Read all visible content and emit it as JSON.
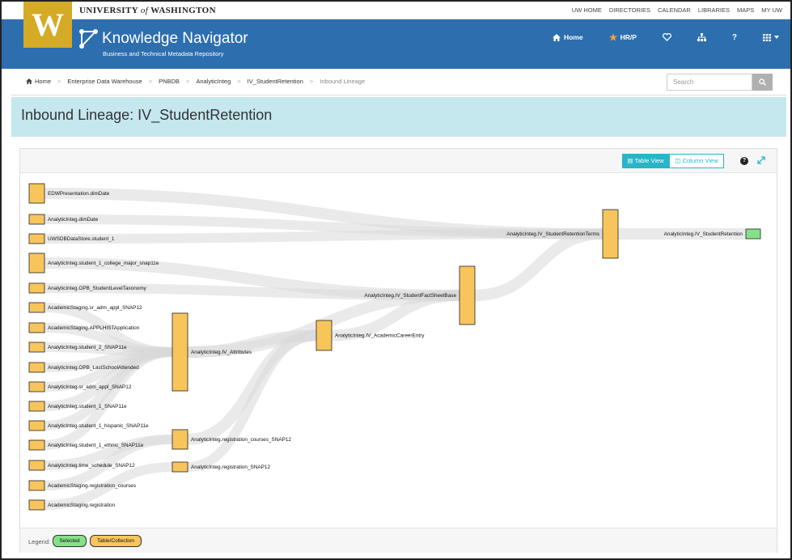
{
  "uw": {
    "logo_letter": "W",
    "name_pre": "UNIVERSITY ",
    "name_of": "of",
    "name_post": " WASHINGTON",
    "links": [
      "UW HOME",
      "DIRECTORIES",
      "CALENDAR",
      "LIBRARIES",
      "MAPS",
      "MY UW"
    ]
  },
  "header": {
    "title": "Knowledge Navigator",
    "subtitle": "Business and Technical Metadata Repository",
    "nav": {
      "home": "Home",
      "hrp": "HR/P"
    }
  },
  "breadcrumb": [
    "Home",
    "Enterprise Data Warehouse",
    "PNBDB",
    "AnalyticInteg",
    "IV_StudentRetention",
    "Inbound Lineage"
  ],
  "search": {
    "placeholder": "Search"
  },
  "page_title": "Inbound Lineage: IV_StudentRetention",
  "toolbar": {
    "table_view": "Table View",
    "column_view": "Column View",
    "help": "?"
  },
  "legend": {
    "label": "Legend:",
    "selected": "Selected",
    "table": "Table/Collection"
  },
  "colors": {
    "table": "#f7c55c",
    "selected": "#86e08a",
    "link": "#d9d9d9",
    "header": "#2d6eaf",
    "accent": "#28b5c8",
    "gold": "#d4aa26"
  },
  "lineage": {
    "nodes": [
      {
        "id": "n0",
        "label": "EDWPresentation.dimDate",
        "level": 0,
        "type": "table"
      },
      {
        "id": "n1",
        "label": "AnalyticInteg.dimDate",
        "level": 0,
        "type": "table"
      },
      {
        "id": "n2",
        "label": "UWSDBDataStore.student_1",
        "level": 0,
        "type": "table"
      },
      {
        "id": "n3",
        "label": "AnalyticInteg.student_1_college_major_snap11e",
        "level": 0,
        "type": "table"
      },
      {
        "id": "n4",
        "label": "AnalyticInteg.OPB_StudentLevelTaxonomy",
        "level": 0,
        "type": "table"
      },
      {
        "id": "n5",
        "label": "AcademicStaging.sr_adm_appl_SNAP12",
        "level": 0,
        "type": "table"
      },
      {
        "id": "n6",
        "label": "AcademicStaging.APPLHISTApplication",
        "level": 0,
        "type": "table"
      },
      {
        "id": "n7",
        "label": "AnalyticInteg.student_2_SNAP11e",
        "level": 0,
        "type": "table"
      },
      {
        "id": "n8",
        "label": "AnalyticInteg.OPB_LastSchoolAttended",
        "level": 0,
        "type": "table"
      },
      {
        "id": "n9",
        "label": "AnalyticInteg.sr_adm_appl_SNAP12",
        "level": 0,
        "type": "table"
      },
      {
        "id": "n10",
        "label": "AnalyticInteg.student_1_SNAP11e",
        "level": 0,
        "type": "table"
      },
      {
        "id": "n11",
        "label": "AnalyticInteg.student_1_hispanic_SNAP11e",
        "level": 0,
        "type": "table"
      },
      {
        "id": "n12",
        "label": "AnalyticInteg.student_1_ethnic_SNAP11e",
        "level": 0,
        "type": "table"
      },
      {
        "id": "n13",
        "label": "AnalyticInteg.time_schedule_SNAP12",
        "level": 0,
        "type": "table"
      },
      {
        "id": "n14",
        "label": "AcademicStaging.registration_courses",
        "level": 0,
        "type": "table"
      },
      {
        "id": "n15",
        "label": "AcademicStaging.registration",
        "level": 0,
        "type": "table"
      },
      {
        "id": "a1",
        "label": "AnalyticInteg.IV_Attributes",
        "level": 1,
        "type": "table"
      },
      {
        "id": "a2",
        "label": "AnalyticInteg.registration_courses_SNAP12",
        "level": 1,
        "type": "table"
      },
      {
        "id": "a3",
        "label": "AnalyticInteg.registration_SNAP12",
        "level": 1,
        "type": "table"
      },
      {
        "id": "c1",
        "label": "AnalyticInteg.IV_AcademicCareerEntry",
        "level": 2,
        "type": "table"
      },
      {
        "id": "f1",
        "label": "AnalyticInteg.IV_StudentFactSheetBase",
        "level": 3,
        "type": "table"
      },
      {
        "id": "t1",
        "label": "AnalyticInteg.IV_StudentRetentionTerms",
        "level": 4,
        "type": "table"
      },
      {
        "id": "r1",
        "label": "AnalyticInteg.IV_StudentRetention",
        "level": 5,
        "type": "selected"
      }
    ],
    "links": [
      [
        "n0",
        "t1"
      ],
      [
        "n1",
        "t1"
      ],
      [
        "n2",
        "t1"
      ],
      [
        "n3",
        "f1"
      ],
      [
        "n4",
        "f1"
      ],
      [
        "n5",
        "a1"
      ],
      [
        "n6",
        "a1"
      ],
      [
        "n7",
        "a1"
      ],
      [
        "n8",
        "a1"
      ],
      [
        "n9",
        "a1"
      ],
      [
        "n10",
        "a1"
      ],
      [
        "n11",
        "a1"
      ],
      [
        "n12",
        "a1"
      ],
      [
        "n13",
        "a2"
      ],
      [
        "n14",
        "a2"
      ],
      [
        "n15",
        "a3"
      ],
      [
        "a1",
        "c1"
      ],
      [
        "a2",
        "c1"
      ],
      [
        "a3",
        "c1"
      ],
      [
        "a1",
        "f1"
      ],
      [
        "c1",
        "f1"
      ],
      [
        "f1",
        "t1"
      ],
      [
        "t1",
        "r1"
      ]
    ]
  }
}
